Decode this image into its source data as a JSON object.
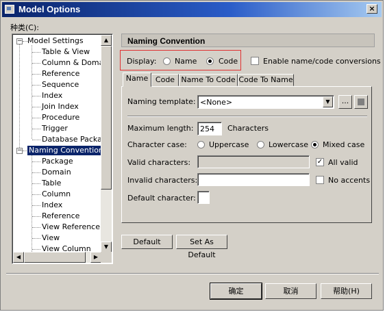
{
  "window": {
    "title": "Model Options",
    "close_glyph": "×"
  },
  "tree": {
    "label": "种类(C):",
    "items": [
      {
        "label": "Model Settings",
        "level": 0,
        "expanded": true
      },
      {
        "label": "Table & View",
        "level": 1
      },
      {
        "label": "Column & Domain",
        "level": 1
      },
      {
        "label": "Reference",
        "level": 1
      },
      {
        "label": "Sequence",
        "level": 1
      },
      {
        "label": "Index",
        "level": 1
      },
      {
        "label": "Join Index",
        "level": 1
      },
      {
        "label": "Procedure",
        "level": 1
      },
      {
        "label": "Trigger",
        "level": 1
      },
      {
        "label": "Database Package",
        "level": 1
      },
      {
        "label": "Naming Convention",
        "level": 0,
        "expanded": true,
        "selected": true
      },
      {
        "label": "Package",
        "level": 1
      },
      {
        "label": "Domain",
        "level": 1
      },
      {
        "label": "Table",
        "level": 1
      },
      {
        "label": "Column",
        "level": 1
      },
      {
        "label": "Index",
        "level": 1
      },
      {
        "label": "Reference",
        "level": 1
      },
      {
        "label": "View Reference",
        "level": 1
      },
      {
        "label": "View",
        "level": 1
      },
      {
        "label": "View Column",
        "level": 1
      }
    ]
  },
  "panel": {
    "title": "Naming Convention",
    "display_label": "Display:",
    "display_options": [
      {
        "label": "Name",
        "checked": false
      },
      {
        "label": "Code",
        "checked": true
      }
    ],
    "enable_conversions": {
      "label": "Enable name/code conversions",
      "checked": false
    },
    "tabs": [
      {
        "label": "Name",
        "active": true
      },
      {
        "label": "Code",
        "active": false
      },
      {
        "label": "Name To Code",
        "active": false
      },
      {
        "label": "Code To Name",
        "active": false
      }
    ],
    "naming_template": {
      "label": "Naming template:",
      "value": "<None>",
      "more_label": "..."
    },
    "max_length": {
      "label": "Maximum length:",
      "value": "254",
      "unit": "Characters"
    },
    "character_case": {
      "label": "Character case:",
      "options": [
        {
          "label": "Uppercase",
          "checked": false
        },
        {
          "label": "Lowercase",
          "checked": false
        },
        {
          "label": "Mixed case",
          "checked": true
        }
      ]
    },
    "valid_characters": {
      "label": "Valid characters:",
      "value": ""
    },
    "all_valid": {
      "label": "All valid",
      "checked": true
    },
    "invalid_characters": {
      "label": "Invalid characters:",
      "value": ""
    },
    "no_accents": {
      "label": "No accents",
      "checked": false
    },
    "default_character": {
      "label": "Default character:",
      "value": ""
    }
  },
  "buttons": {
    "default": "Default",
    "set_as_default": "Set As Default",
    "ok": "确定",
    "cancel": "取消",
    "help": "帮助(H)"
  },
  "colors": {
    "selection": "#0a246a",
    "highlight_box": "#e03030",
    "dialog_bg": "#d4d0c8"
  }
}
